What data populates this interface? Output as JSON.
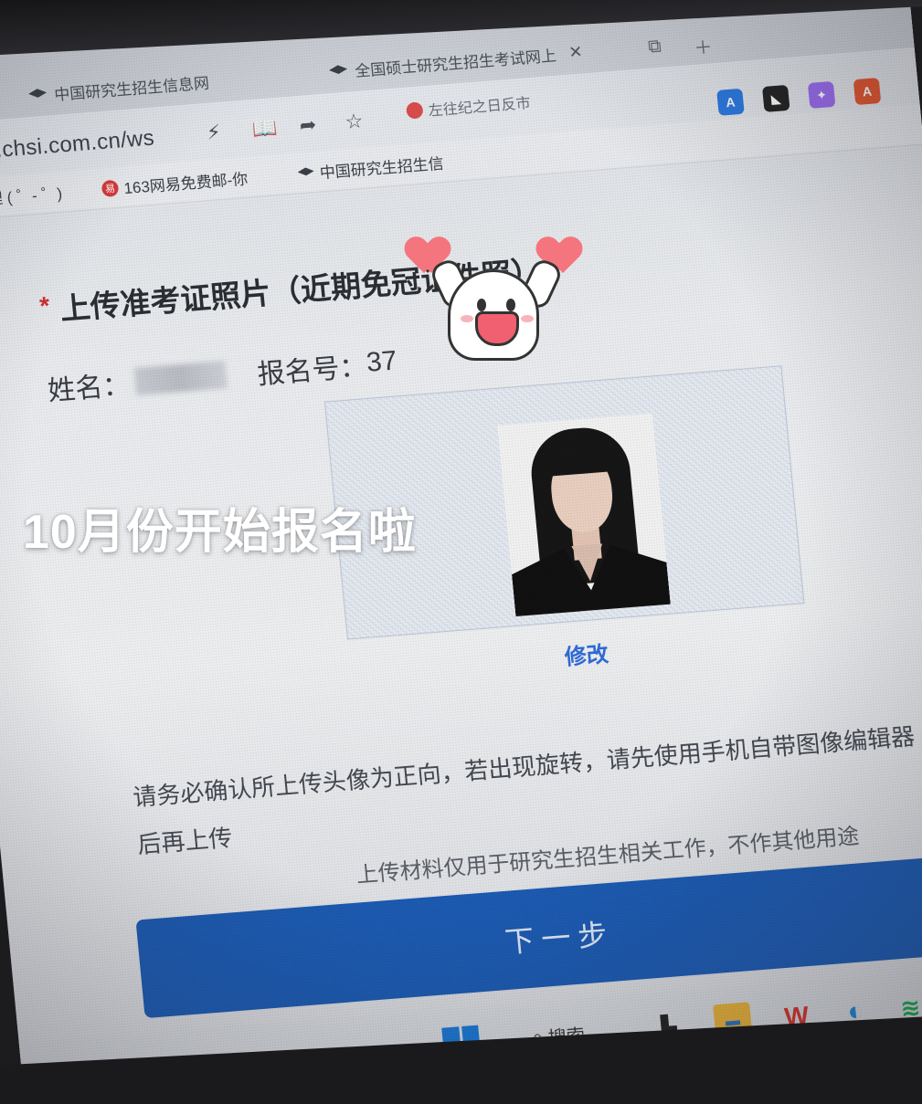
{
  "browser": {
    "tabs": [
      {
        "label": "中国研究生招生信息网"
      },
      {
        "label": "全国硕士研究生招生考试网上"
      }
    ],
    "url": "//yz.chsi.com.cn/ws",
    "ad_text": "左往纪之日反市",
    "bookmarks": [
      {
        "label": "哩哩哩 ( ゜- ゜)"
      },
      {
        "label": "163网易免费邮-你"
      },
      {
        "label": "中国研究生招生信"
      }
    ]
  },
  "page": {
    "required_mark": "*",
    "title": "上传准考证照片（近期免冠证件照）",
    "name_label": "姓名：",
    "reg_label": "报名号：",
    "reg_value": "37",
    "modify_label": "修改",
    "notice_line1": "请务必确认所上传头像为正向，若出现旋转，请先使用手机自带图像编辑器",
    "notice_line2": "后再上传",
    "notice_secondary": "上传材料仅用于研究生招生相关工作，不作其他用途",
    "next_button": "下一步"
  },
  "taskbar": {
    "search_label": "搜索"
  },
  "overlay": {
    "caption": "10月份开始报名啦"
  },
  "colors": {
    "primary_button": "#1c5bb3",
    "link": "#2f6bd8",
    "required": "#d32f2f",
    "windows_blue": "#1a78d4"
  },
  "icons": [
    "graduation-cap-icon",
    "close-icon",
    "lightning-icon",
    "reader-icon",
    "share-icon",
    "star-icon",
    "translate-icon",
    "windows-icon",
    "search-icon",
    "file-explorer-icon",
    "wps-icon",
    "edge-icon",
    "wechat-icon"
  ]
}
